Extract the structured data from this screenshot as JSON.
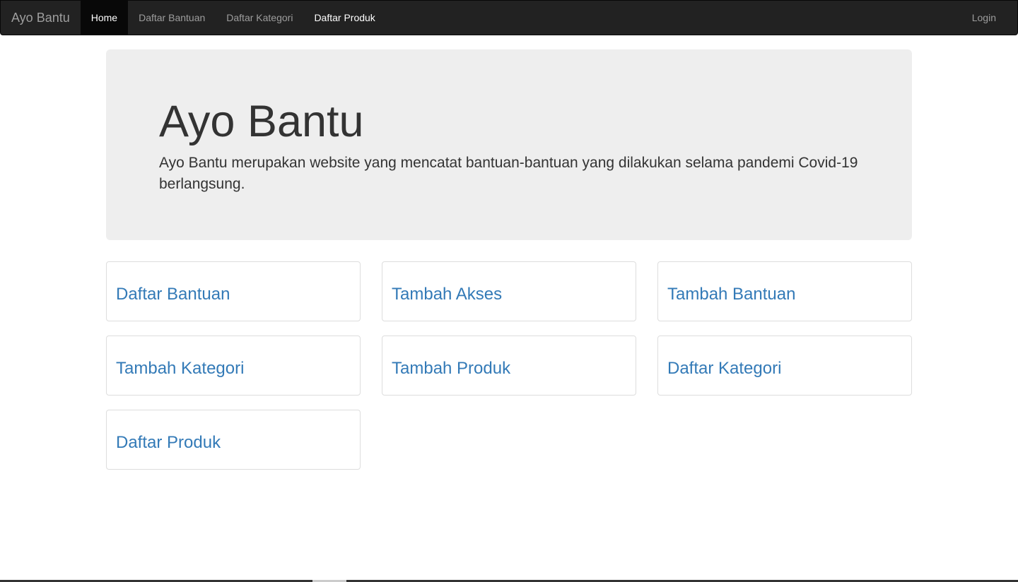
{
  "navbar": {
    "brand": "Ayo Bantu",
    "links": [
      {
        "label": "Home",
        "state": "active"
      },
      {
        "label": "Daftar Bantuan",
        "state": "normal"
      },
      {
        "label": "Daftar Kategori",
        "state": "normal"
      },
      {
        "label": "Daftar Produk",
        "state": "highlighted"
      }
    ],
    "login_label": "Login"
  },
  "jumbotron": {
    "title": "Ayo Bantu",
    "description": "Ayo Bantu merupakan website yang mencatat bantuan-bantuan yang dilakukan selama pandemi Covid-19 berlangsung."
  },
  "cards": [
    {
      "label": "Daftar Bantuan"
    },
    {
      "label": "Tambah Akses"
    },
    {
      "label": "Tambah Bantuan"
    },
    {
      "label": "Tambah Kategori"
    },
    {
      "label": "Tambah Produk"
    },
    {
      "label": "Daftar Kategori"
    },
    {
      "label": "Daftar Produk"
    }
  ],
  "colors": {
    "navbar_bg": "#222222",
    "active_tab_bg": "#080808",
    "jumbotron_bg": "#eeeeee",
    "link": "#337ab7"
  }
}
